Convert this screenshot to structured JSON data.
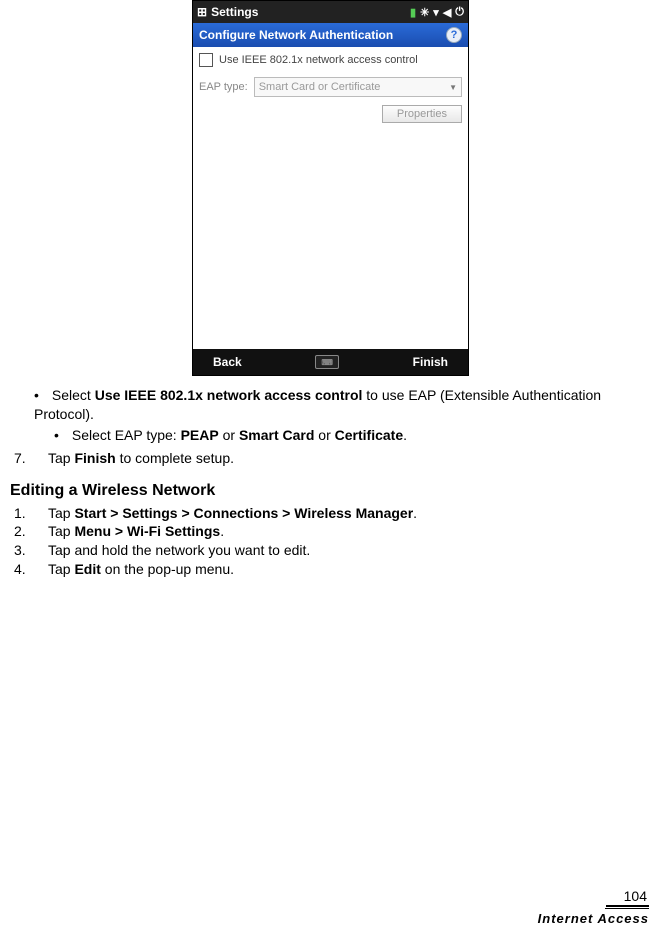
{
  "phone": {
    "statusbar_title": "Settings",
    "titlebar": "Configure Network Authentication",
    "help_glyph": "?",
    "checkbox_label": "Use IEEE 802.1x network access control",
    "eap_label": "EAP type:",
    "eap_value": "Smart Card or Certificate",
    "properties_btn": "Properties",
    "bottombar_left": "Back",
    "bottombar_right": "Finish"
  },
  "doc": {
    "bullet1_pre": "Select ",
    "bullet1_bold": "Use IEEE 802.1x network access control",
    "bullet1_post": " to use EAP (Extensible Authentication Protocol).",
    "bullet1a_pre": "Select EAP type: ",
    "bullet1a_b1": "PEAP",
    "bullet1a_mid1": " or ",
    "bullet1a_b2": "Smart Card",
    "bullet1a_mid2": " or ",
    "bullet1a_b3": "Certificate",
    "bullet1a_post": ".",
    "step7_num": "7.",
    "step7_pre": "Tap ",
    "step7_bold": "Finish",
    "step7_post": " to complete setup.",
    "heading": "Editing a Wireless Network",
    "ol": [
      {
        "num": "1.",
        "pre": "Tap ",
        "bold": "Start > Settings > Connections > Wireless Manager",
        "post": "."
      },
      {
        "num": "2.",
        "pre": "Tap ",
        "bold": "Menu > Wi-Fi Settings",
        "post": "."
      },
      {
        "num": "3.",
        "pre": "Tap and hold the network you want to edit.",
        "bold": "",
        "post": ""
      },
      {
        "num": "4.",
        "pre": "Tap ",
        "bold": "Edit",
        "post": " on the pop-up menu."
      }
    ]
  },
  "footer": {
    "page": "104",
    "section": "Internet Access"
  }
}
